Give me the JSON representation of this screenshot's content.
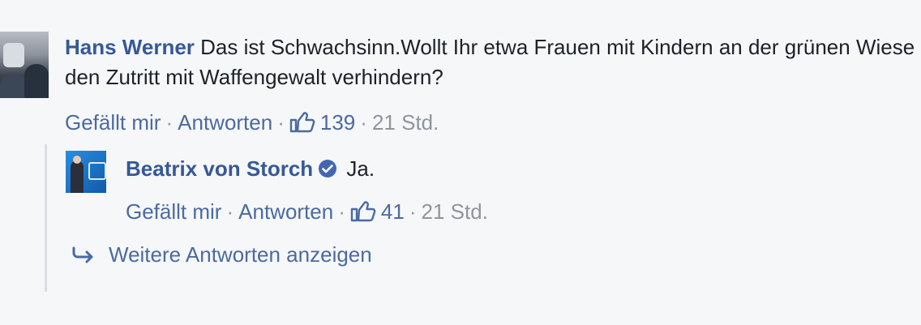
{
  "comment": {
    "author": "Hans Werner",
    "text": "Das ist Schwachsinn.Wollt Ihr etwa Frauen mit Kindern an der grünen Wiese den Zutritt mit Waffengewalt verhindern?",
    "actions": {
      "like_label": "Gefällt mir",
      "reply_label": "Antworten",
      "separator": "·",
      "like_count": "139",
      "time": "21 Std."
    }
  },
  "reply": {
    "author": "Beatrix von Storch",
    "verified": true,
    "text": "Ja.",
    "actions": {
      "like_label": "Gefällt mir",
      "reply_label": "Antworten",
      "separator": "·",
      "like_count": "41",
      "time": "21 Std."
    }
  },
  "more_replies": {
    "label": "Weitere Antworten anzeigen"
  },
  "colors": {
    "link": "#365899",
    "action": "#4b6aa0",
    "text": "#1d2129",
    "meta": "#90949c",
    "background": "#f6f7f9",
    "verified": "#4267b2"
  },
  "icons": {
    "like": "thumbs-up-icon",
    "verified": "verified-badge-icon",
    "more": "reply-arrow-icon"
  }
}
